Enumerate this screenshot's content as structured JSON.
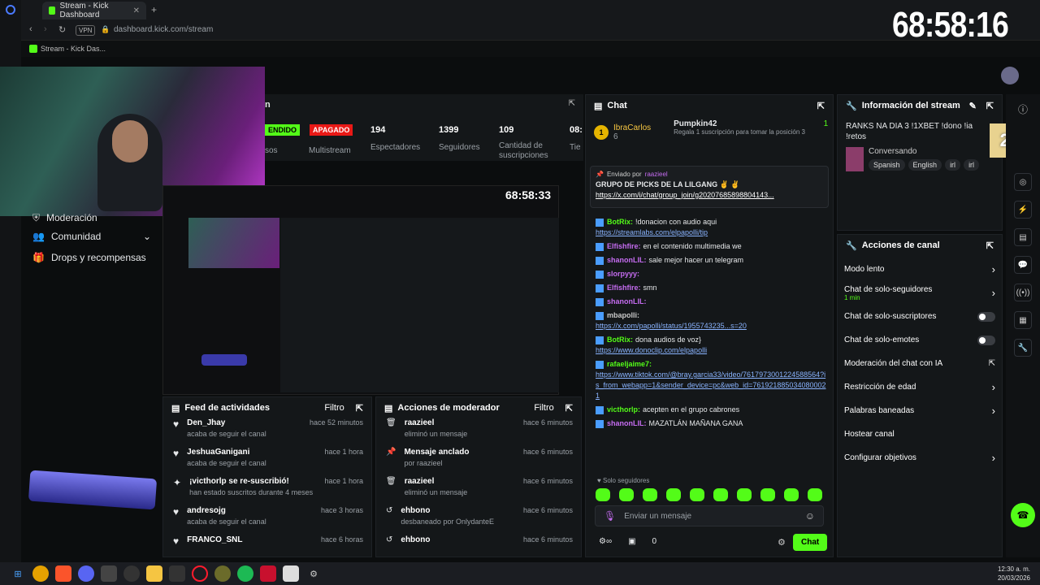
{
  "browser": {
    "tab_title": "Stream - Kick Dashboard",
    "vpn_label": "VPN",
    "url": "dashboard.kick.com/stream",
    "bookmark": "Stream - Kick Das..."
  },
  "overlay_timer": "68:58:16",
  "preview_timer": "68:58:33",
  "viewer_overlay": "231",
  "stats": {
    "title_partial": "n",
    "on_badge": "ENDIDO",
    "off_badge": "APAGADO",
    "left_label": "sos",
    "multistream_label": "Multistream",
    "viewers_value": "194",
    "viewers_label": "Espectadores",
    "followers_value": "1399",
    "followers_label": "Seguidores",
    "subs_value": "109",
    "subs_label": "Cantidad de suscripciones",
    "time_value": "08:",
    "time_label": "Tie"
  },
  "leftnav": {
    "items": [
      {
        "label": "Moderación"
      },
      {
        "label": "Comunidad"
      },
      {
        "label": "Drops y recompensas"
      }
    ]
  },
  "feed": {
    "title": "Feed de actividades",
    "filter": "Filtro",
    "rows": [
      {
        "name": "Den_Jhay",
        "sub": "acaba de seguir el canal",
        "time": "hace 52 minutos",
        "icon": "heart"
      },
      {
        "name": "JeshuaGanigani",
        "sub": "acaba de seguir el canal",
        "time": "hace 1 hora",
        "icon": "heart"
      },
      {
        "name": "¡victhorlp se re-suscribió!",
        "sub": "han estado suscritos durante 4 meses",
        "time": "hace 1 hora",
        "icon": "star"
      },
      {
        "name": "andresojg",
        "sub": "acaba de seguir el canal",
        "time": "hace 3 horas",
        "icon": "heart"
      },
      {
        "name": "FRANCO_SNL",
        "sub": "",
        "time": "hace 6 horas",
        "icon": "heart"
      }
    ]
  },
  "modactions": {
    "title": "Acciones de moderador",
    "filter": "Filtro",
    "rows": [
      {
        "name": "raazieel",
        "sub": "eliminó un mensaje",
        "time": "hace 6 minutos"
      },
      {
        "name": "Mensaje anclado",
        "sub": "por raazieel",
        "time": "hace 6 minutos"
      },
      {
        "name": "raazieel",
        "sub": "eliminó un mensaje",
        "time": "hace 6 minutos"
      },
      {
        "name": "ehbono",
        "sub": "desbaneado por OnlydanteE",
        "time": "hace 6 minutos"
      },
      {
        "name": "ehbono",
        "sub": "",
        "time": "hace 6 minutos"
      }
    ]
  },
  "chat": {
    "title": "Chat",
    "top_user": "IbraCarlos",
    "top_count": "6",
    "top_rank": "1",
    "pumpkin": "Pumpkin42",
    "pumpkin_count": "1",
    "pumpkin_text": "Regala 1 suscripción para tomar la posición 3",
    "pinned_by": "Enviado por",
    "pinned_user": "raazieel",
    "pinned_text": "GRUPO DE PICKS DE LA LILGANG ✌️ ✌️",
    "pinned_link": "https://x.com/i/chat/group_join/g20207685898804143...",
    "messages": [
      {
        "user": "BotRix:",
        "color": "#53fc18",
        "text": "!donacion con audio aqui",
        "link": "https://streamlabs.com/elpapolli/tip"
      },
      {
        "user": "Elfishfire:",
        "color": "#c56cf0",
        "text": "en el contenido multimedia we",
        "link": ""
      },
      {
        "user": "shanonLIL:",
        "color": "#c56cf0",
        "text": "sale mejor hacer un telegram",
        "link": ""
      },
      {
        "user": "slorpyyy:",
        "color": "#c56cf0",
        "text": "",
        "link": ""
      },
      {
        "user": "Elfishfire:",
        "color": "#c56cf0",
        "text": "smn",
        "link": ""
      },
      {
        "user": "shanonLIL:",
        "color": "#c56cf0",
        "text": "",
        "link": ""
      },
      {
        "user": "mbapolli:",
        "color": "#c8c8c8",
        "text": "",
        "link": "https://x.com/papolli/status/1955743235...s=20"
      },
      {
        "user": "BotRix:",
        "color": "#53fc18",
        "text": "dona audios de voz}",
        "link": "https://www.donoclip.com/elpapolli"
      },
      {
        "user": "rafaeljaime7:",
        "color": "#53fc18",
        "text": "",
        "link": "https://www.tiktok.com/@bray.garcia33/video/7617973001224588564?is_from_webapp=1&sender_device=pc&web_id=7619218850340800021"
      },
      {
        "user": "victhorlp:",
        "color": "#53fc18",
        "text": "acepten en el grupo cabrones",
        "link": ""
      },
      {
        "user": "shanonLIL:",
        "color": "#c56cf0",
        "text": "MAZATLÁN MAÑANA GANA",
        "link": ""
      }
    ],
    "followers_only": "Solo seguidores",
    "input_placeholder": "Enviar un mensaje",
    "points": "0",
    "send": "Chat"
  },
  "info": {
    "title": "Información del stream",
    "stream_title": "RANKS NA DIA 3 !1XBET !dono !ia !retos",
    "category": "Conversando",
    "tags": [
      "Spanish",
      "English",
      "irl",
      "irl"
    ]
  },
  "actions": {
    "title": "Acciones de canal",
    "items": [
      {
        "label": "Modo lento",
        "sub": "",
        "type": "chevron"
      },
      {
        "label": "Chat de solo-seguidores",
        "sub": "1 min",
        "type": "chevron"
      },
      {
        "label": "Chat de solo-suscriptores",
        "sub": "",
        "type": "toggle"
      },
      {
        "label": "Chat de solo-emotes",
        "sub": "",
        "type": "toggle"
      },
      {
        "label": "Moderación del chat con IA",
        "sub": "",
        "type": "external"
      },
      {
        "label": "Restricción de edad",
        "sub": "",
        "type": "chevron"
      },
      {
        "label": "Palabras baneadas",
        "sub": "",
        "type": "chevron"
      },
      {
        "label": "Hostear canal",
        "sub": "",
        "type": "none"
      },
      {
        "label": "Configurar objetivos",
        "sub": "",
        "type": "chevron"
      }
    ]
  },
  "taskbar": {
    "time": "12:30 a. m.",
    "date": "20/03/2026"
  },
  "colors": {
    "accent": "#53fc18",
    "danger": "#e91916",
    "bg": "#0b0d0e",
    "panel": "#141719"
  }
}
